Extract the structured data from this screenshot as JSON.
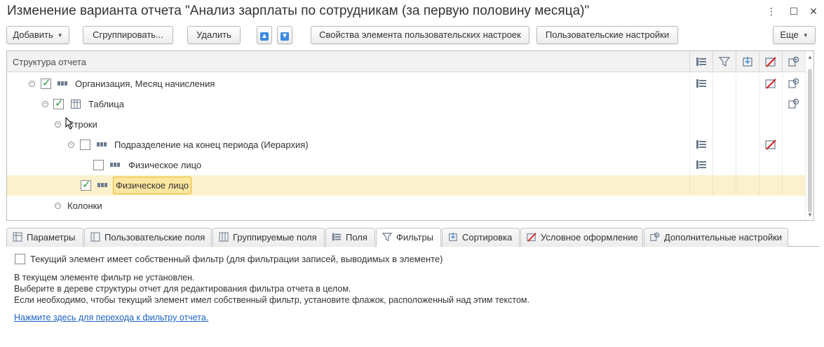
{
  "window": {
    "title": "Изменение варианта отчета \"Анализ зарплаты по сотрудникам (за первую половину месяца)\"",
    "more_icon": "more-icon",
    "maximize_icon": "maximize-icon",
    "close_icon": "close-icon"
  },
  "toolbar": {
    "add_label": "Добавить",
    "group_label": "Сгруппировать...",
    "delete_label": "Удалить",
    "element_props_label": "Свойства элемента пользовательских настроек",
    "user_settings_label": "Пользовательские настройки",
    "more_label": "Еще",
    "more_icon": "dropdown-icon",
    "up_icon": "arrow-up-icon",
    "down_icon": "arrow-down-icon"
  },
  "tree": {
    "header": "Структура отчета",
    "rows": [
      {
        "text": "Организация, Месяц начисления",
        "checked": true
      },
      {
        "text": "Таблица",
        "checked": true
      },
      {
        "text": "Строки"
      },
      {
        "text": "Подразделение на конец периода (Иерархия)",
        "checked": false
      },
      {
        "text": "Физическое лицо",
        "checked": false
      },
      {
        "text": "Физическое лицо",
        "checked": true,
        "selected": true
      },
      {
        "text": "Колонки"
      }
    ]
  },
  "tabs": [
    {
      "label": "Параметры",
      "icon": "params-icon"
    },
    {
      "label": "Пользовательские поля",
      "icon": "user-fields-icon"
    },
    {
      "label": "Группируемые поля",
      "icon": "grouped-fields-icon"
    },
    {
      "label": "Поля",
      "icon": "fields-icon"
    },
    {
      "label": "Фильтры",
      "icon": "filter-icon",
      "active": true
    },
    {
      "label": "Сортировка",
      "icon": "sort-icon"
    },
    {
      "label": "Условное оформление",
      "icon": "conditional-format-icon"
    },
    {
      "label": "Дополнительные настройки",
      "icon": "settings-icon"
    }
  ],
  "filters_panel": {
    "own_filter_label": "Текущий элемент имеет собственный фильтр (для фильтрации записей, выводимых в элементе)",
    "own_filter_checked": false,
    "info_line1": "В текущем элементе фильтр не установлен.",
    "info_line2": "Выберите в дереве структуры отчет для редактирования фильтра отчета в целом.",
    "info_line3": "Если необходимо, чтобы текущий элемент имел собственный фильтр, установите флажок, расположенный над этим текстом.",
    "link_text": "Нажмите здесь для перехода к фильтру отчета."
  },
  "colors": {
    "selected_row": "#fbf1cc",
    "selection_border": "#e7b820",
    "check_green": "#1a9a3a",
    "link": "#1e64c8",
    "accent_blue": "#3d8ae3"
  }
}
